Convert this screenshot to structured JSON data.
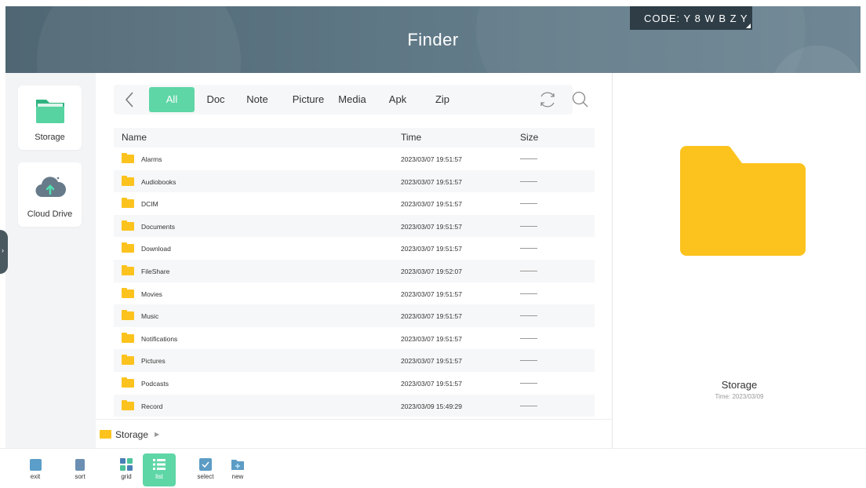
{
  "header": {
    "title": "Finder",
    "code_badge": "CODE: Y 8 W B Z Y"
  },
  "sidebar": {
    "items": [
      {
        "label": "Storage",
        "icon": "folder-icon"
      },
      {
        "label": "Cloud Drive",
        "icon": "cloud-upload-icon"
      }
    ]
  },
  "tabs": [
    {
      "label": "All",
      "active": true
    },
    {
      "label": "Doc"
    },
    {
      "label": "Note"
    },
    {
      "label": "Picture"
    },
    {
      "label": "Media"
    },
    {
      "label": "Apk"
    },
    {
      "label": "Zip"
    }
  ],
  "table": {
    "headers": {
      "name": "Name",
      "time": "Time",
      "size": "Size"
    },
    "rows": [
      {
        "name": "Alarms",
        "time": "2023/03/07 19:51:57",
        "size": "——"
      },
      {
        "name": "Audiobooks",
        "time": "2023/03/07 19:51:57",
        "size": "——"
      },
      {
        "name": "DCIM",
        "time": "2023/03/07 19:51:57",
        "size": "——"
      },
      {
        "name": "Documents",
        "time": "2023/03/07 19:51:57",
        "size": "——"
      },
      {
        "name": "Download",
        "time": "2023/03/07 19:51:57",
        "size": "——"
      },
      {
        "name": "FileShare",
        "time": "2023/03/07 19:52:07",
        "size": "——"
      },
      {
        "name": "Movies",
        "time": "2023/03/07 19:51:57",
        "size": "——"
      },
      {
        "name": "Music",
        "time": "2023/03/07 19:51:57",
        "size": "——"
      },
      {
        "name": "Notifications",
        "time": "2023/03/07 19:51:57",
        "size": "——"
      },
      {
        "name": "Pictures",
        "time": "2023/03/07 19:51:57",
        "size": "——"
      },
      {
        "name": "Podcasts",
        "time": "2023/03/07 19:51:57",
        "size": "——"
      },
      {
        "name": "Record",
        "time": "2023/03/09 15:49:29",
        "size": "——"
      }
    ]
  },
  "breadcrumb": {
    "label": "Storage"
  },
  "preview": {
    "name": "Storage",
    "time": "Time: 2023/03/09"
  },
  "toolbar": {
    "exit": "exit",
    "sort": "sort",
    "grid": "grid",
    "list": "list",
    "select": "select",
    "new": "new"
  },
  "colors": {
    "accent": "#5ed6a6",
    "folder": "#fcc31f",
    "header": "#5f7886"
  }
}
